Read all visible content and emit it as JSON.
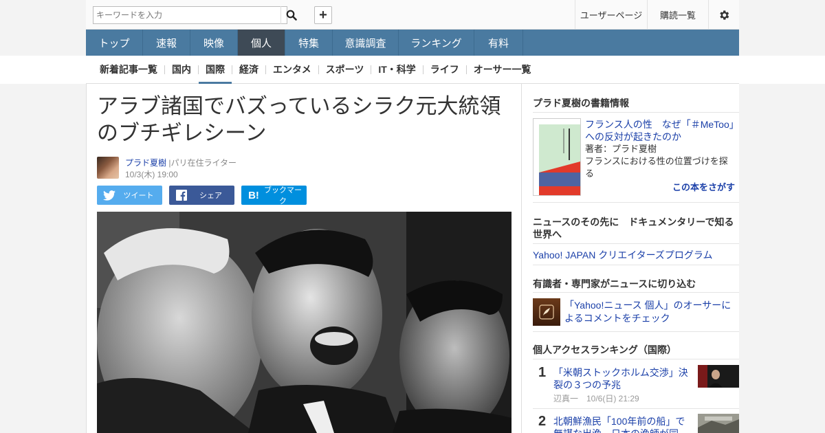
{
  "header": {
    "search_placeholder": "キーワードを入力",
    "user_page": "ユーザーページ",
    "subscriptions": "購読一覧"
  },
  "main_nav": [
    {
      "label": "トップ",
      "active": false
    },
    {
      "label": "速報",
      "active": false
    },
    {
      "label": "映像",
      "active": false
    },
    {
      "label": "個人",
      "active": true
    },
    {
      "label": "特集",
      "active": false
    },
    {
      "label": "意識調査",
      "active": false
    },
    {
      "label": "ランキング",
      "active": false
    },
    {
      "label": "有料",
      "active": false
    }
  ],
  "sub_nav": [
    {
      "label": "新着記事一覧",
      "active": false
    },
    {
      "label": "国内",
      "active": false
    },
    {
      "label": "国際",
      "active": true
    },
    {
      "label": "経済",
      "active": false
    },
    {
      "label": "エンタメ",
      "active": false
    },
    {
      "label": "スポーツ",
      "active": false
    },
    {
      "label": "IT・科学",
      "active": false
    },
    {
      "label": "ライフ",
      "active": false
    },
    {
      "label": "オーサー一覧",
      "active": false
    }
  ],
  "article": {
    "title_line1": "アラブ諸国でバズっているシラク元大統領",
    "title_line2": "のブチギレシーン",
    "author": "プラド夏樹",
    "author_role": "|パリ在住ライター",
    "date": "10/3(木) 19:00",
    "share_tweet": "ツイート",
    "share_facebook": "シェア",
    "share_hatena": "ブックマーク",
    "hatena_mark": "B!"
  },
  "sidebar": {
    "book_heading": "プラド夏樹の書籍情報",
    "book_title": "フランス人の性　なぜ「＃MeToo」への反対が起きたのか",
    "book_author": "著者：プラド夏樹",
    "book_desc": "フランスにおける性の位置づけを探る",
    "book_find": "この本をさがす",
    "doc_heading": "ニュースのその先に　ドキュメンタリーで知る世界へ",
    "creators_link": "Yahoo! JAPAN クリエイターズプログラム",
    "expert_heading": "有識者・専門家がニュースに切り込む",
    "expert_text": "「Yahoo!ニュース 個人」のオーサーによるコメントをチェック",
    "ranking_heading": "個人アクセスランキング（国際）",
    "ranking": [
      {
        "num": "1",
        "title": "「米朝ストックホルム交渉」決裂の３つの予兆",
        "meta": "辺真一　10/6(日) 21:29"
      },
      {
        "num": "2",
        "title": "北朝鮮漁民「100年前の船」で無謀な出漁…日本の漁師が同",
        "meta": ""
      }
    ]
  },
  "colors": {
    "nav_bg": "#4a7aa0",
    "nav_active": "#3e4a56",
    "link": "#1a3fa8",
    "twitter": "#55acee",
    "facebook": "#3b5998",
    "hatena": "#008fde"
  }
}
